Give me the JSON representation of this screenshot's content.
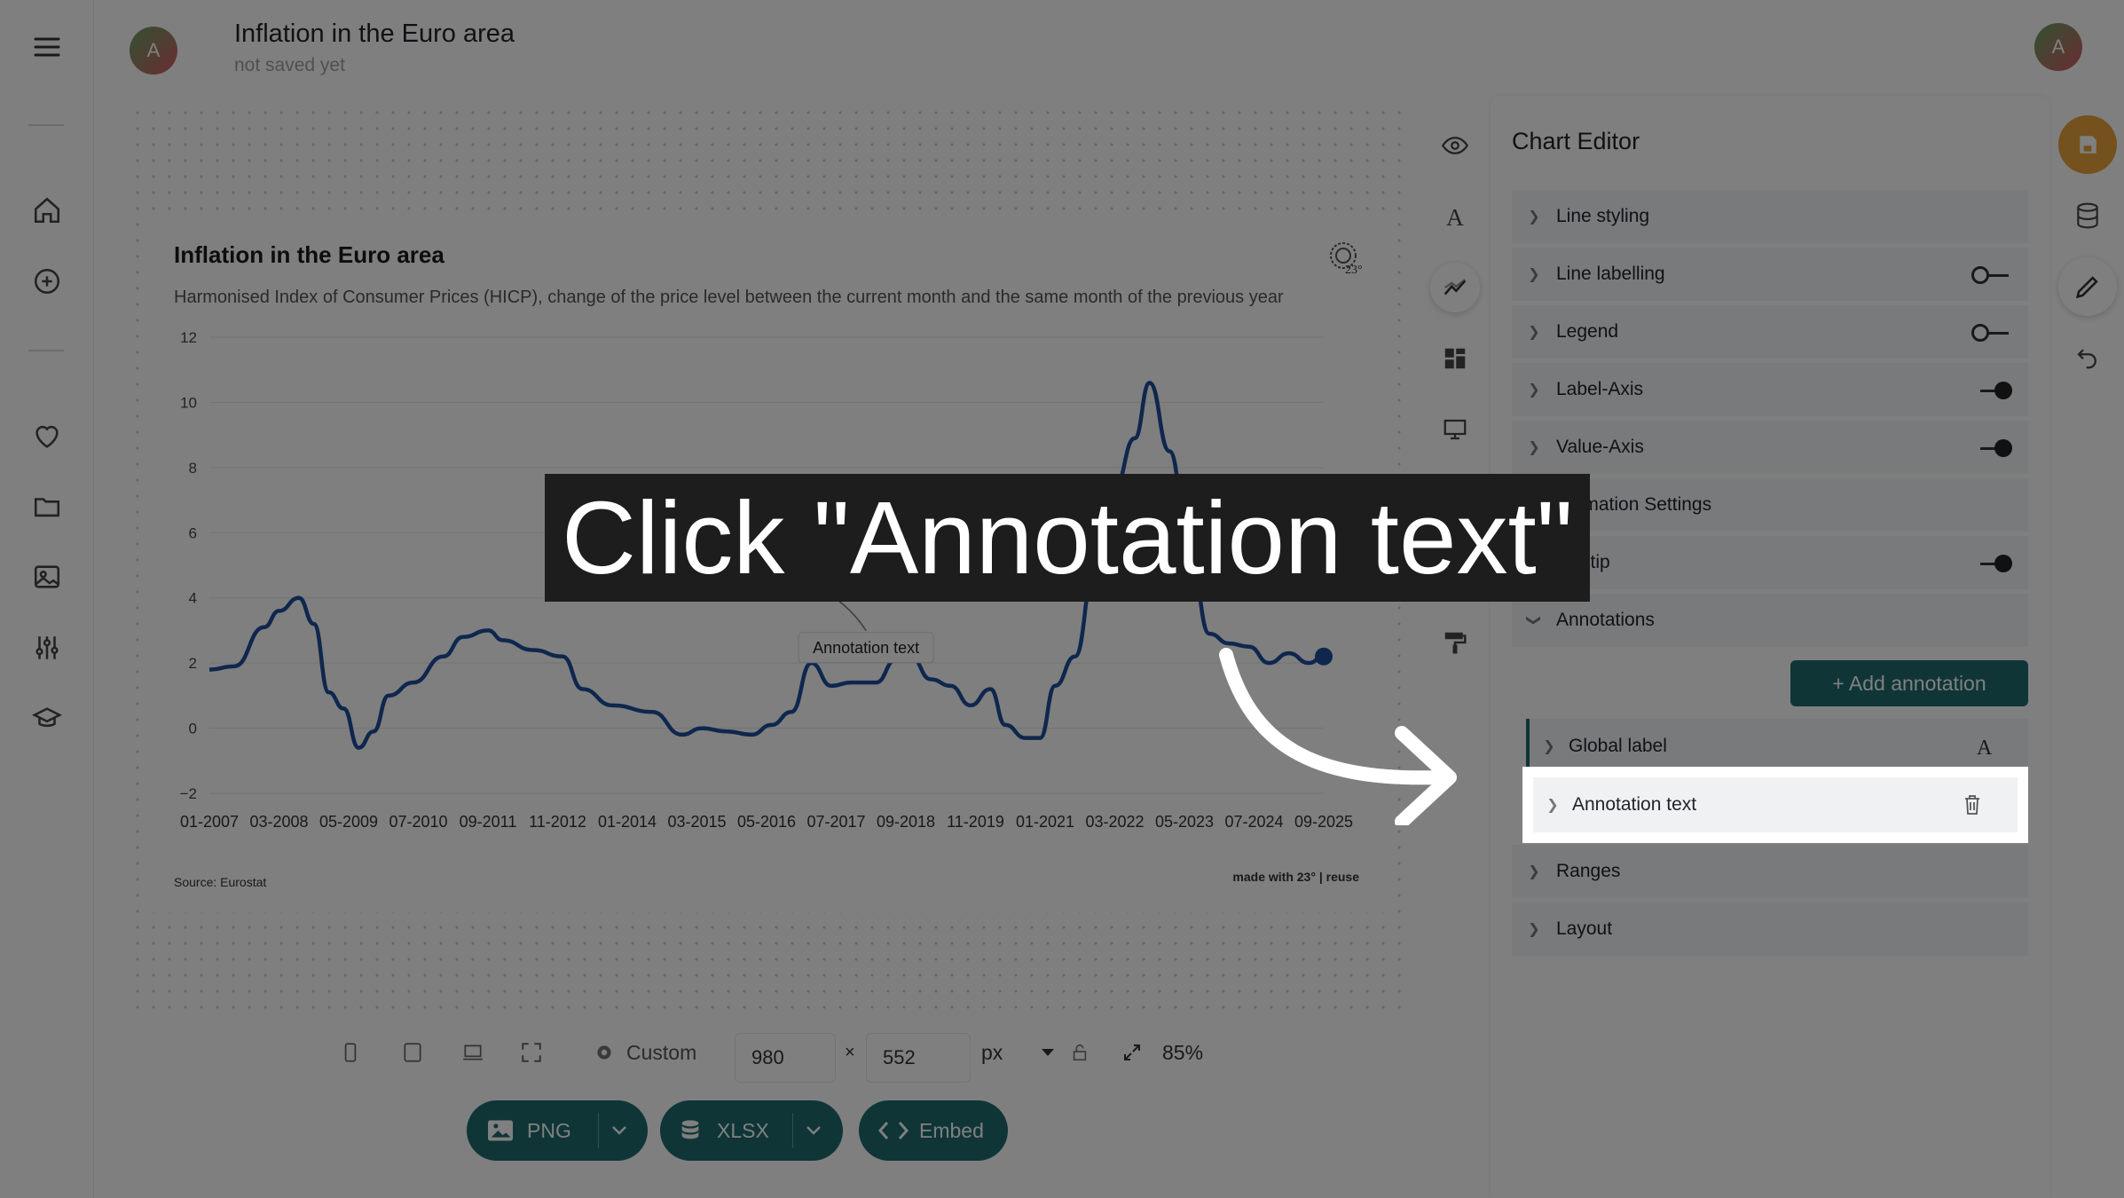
{
  "header": {
    "avatar_letter": "A",
    "title": "Inflation in the Euro area",
    "subtitle": "not saved yet"
  },
  "left_rail": {
    "icons": [
      "menu-icon",
      "home-icon",
      "add-circle-icon",
      "heart-icon",
      "folder-icon",
      "image-icon",
      "sliders-icon",
      "graduation-cap-icon"
    ]
  },
  "chart_card": {
    "title": "Inflation in the Euro area",
    "subtitle": "Harmonised Index of Consumer Prices (HICP), change of the price level between the current month and the same month of the previous year",
    "source": "Source: Eurostat",
    "credit": "made with 23° | reuse",
    "annotation_label": "Annotation text"
  },
  "chart_data": {
    "type": "line",
    "title": "Inflation in the Euro area",
    "subtitle": "Harmonised Index of Consumer Prices (HICP), change of the price level between the current month and the same month of the previous year",
    "ylim": [
      -2,
      12
    ],
    "yticks": [
      "12",
      "10",
      "8",
      "6",
      "4",
      "2",
      "0",
      "−2"
    ],
    "ytick_values": [
      12,
      10,
      8,
      6,
      4,
      2,
      0,
      -2
    ],
    "xticks": [
      "01-2007",
      "03-2008",
      "05-2009",
      "07-2010",
      "09-2011",
      "11-2012",
      "01-2014",
      "03-2015",
      "05-2016",
      "07-2017",
      "09-2018",
      "11-2019",
      "01-2021",
      "03-2022",
      "05-2023",
      "07-2024",
      "09-2025"
    ],
    "series": [
      {
        "color": "#1f4e9c",
        "x": [
          "2007-01",
          "2007-06",
          "2007-12",
          "2008-03",
          "2008-07",
          "2008-10",
          "2009-01",
          "2009-04",
          "2009-07",
          "2009-10",
          "2010-01",
          "2010-06",
          "2010-12",
          "2011-04",
          "2011-09",
          "2011-12",
          "2012-06",
          "2012-12",
          "2013-04",
          "2013-10",
          "2014-06",
          "2014-12",
          "2015-04",
          "2015-09",
          "2016-02",
          "2016-06",
          "2016-10",
          "2017-02",
          "2017-06",
          "2017-10",
          "2018-03",
          "2018-07",
          "2018-10",
          "2019-02",
          "2019-06",
          "2019-10",
          "2020-02",
          "2020-05",
          "2020-09",
          "2020-12",
          "2021-03",
          "2021-07",
          "2021-11",
          "2022-03",
          "2022-07",
          "2022-10",
          "2023-02",
          "2023-06",
          "2023-10",
          "2024-02",
          "2024-06",
          "2024-10",
          "2025-02",
          "2025-06",
          "2025-09"
        ],
        "values": [
          1.8,
          1.9,
          3.1,
          3.6,
          4.0,
          3.2,
          1.1,
          0.6,
          -0.6,
          -0.1,
          1.0,
          1.4,
          2.2,
          2.8,
          3.0,
          2.7,
          2.4,
          2.2,
          1.2,
          0.7,
          0.5,
          -0.2,
          0.0,
          -0.1,
          -0.2,
          0.1,
          0.5,
          2.0,
          1.3,
          1.4,
          1.4,
          2.1,
          2.2,
          1.5,
          1.3,
          0.7,
          1.2,
          0.1,
          -0.3,
          -0.3,
          1.3,
          2.2,
          4.9,
          7.4,
          8.9,
          10.6,
          8.5,
          5.5,
          2.9,
          2.6,
          2.5,
          2.0,
          2.3,
          2.0,
          2.2
        ]
      }
    ],
    "grid": true,
    "legend": "none"
  },
  "tools": {
    "icons": [
      "eye-icon",
      "typography-icon",
      "line-chart-icon",
      "layout-icon",
      "device-icon",
      "branch-icon",
      "paint-roller-icon"
    ]
  },
  "size_bar": {
    "preset_label": "Custom",
    "width_value": "980",
    "height_value": "552",
    "times": "×",
    "unit": "px",
    "zoom": "85%"
  },
  "export": {
    "png": "PNG",
    "xlsx": "XLSX",
    "embed": "Embed"
  },
  "editor": {
    "title": "Chart Editor",
    "sections": [
      {
        "label": "Line styling"
      },
      {
        "label": "Line labelling",
        "toggle": "off"
      },
      {
        "label": "Legend",
        "toggle": "off"
      },
      {
        "label": "Label-Axis",
        "toggle": "on"
      },
      {
        "label": "Value-Axis",
        "toggle": "on"
      },
      {
        "label": "Animation Settings"
      },
      {
        "label": "Tooltip",
        "toggle": "on"
      },
      {
        "label": "Annotations"
      }
    ],
    "add_annotation": "+ Add annotation",
    "annotations": [
      "Global label",
      "Annotation text"
    ],
    "after_sections": [
      "Ranges",
      "Layout"
    ]
  },
  "right_rail": {
    "icons": [
      "save-icon",
      "database-icon",
      "pencil-icon",
      "undo-icon"
    ],
    "accent": "#e8a33a"
  },
  "overlay": {
    "instruction": "Click \"Annotation text\""
  }
}
